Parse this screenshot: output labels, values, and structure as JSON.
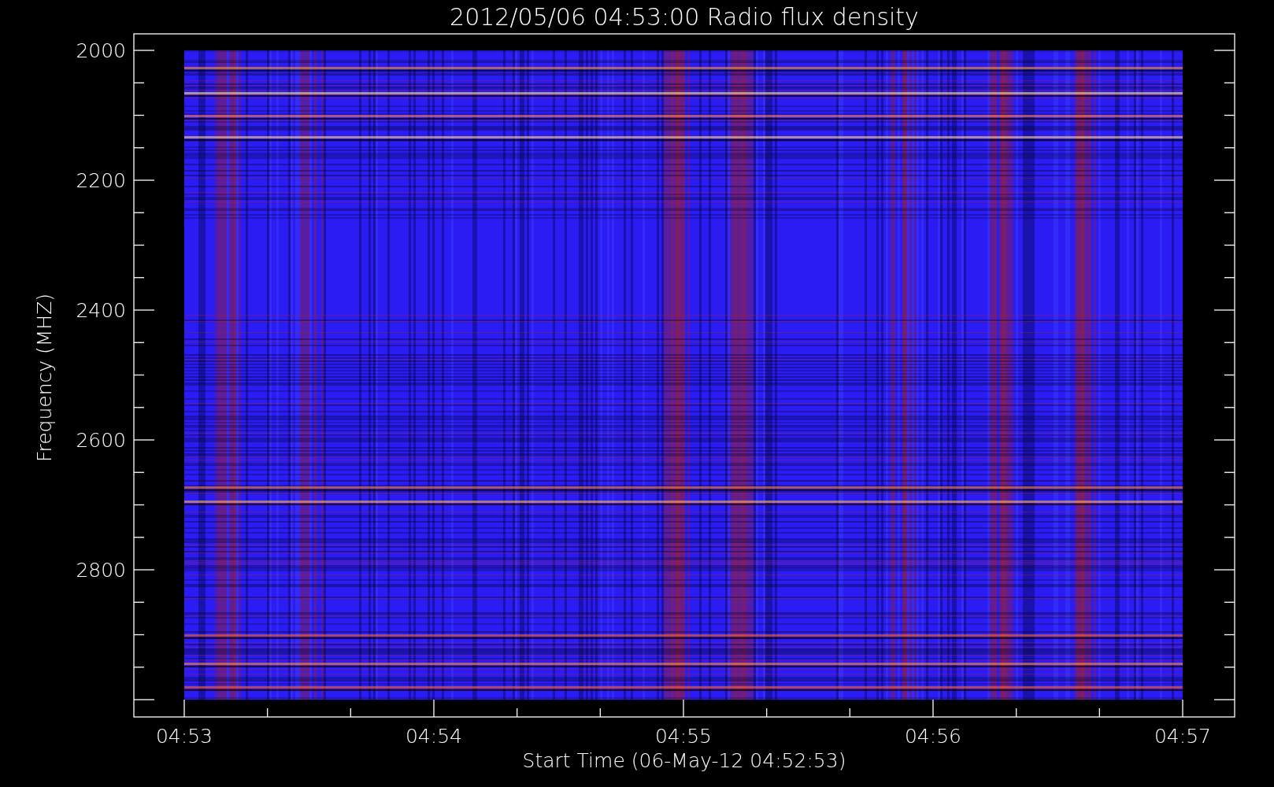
{
  "plot": {
    "title": "2012/05/06 04:53:00 Radio flux density",
    "y_axis": {
      "label": "Frequency (MHZ)",
      "ticks": [
        "2000",
        "2200",
        "2400",
        "2600",
        "2800"
      ]
    },
    "x_axis": {
      "label": "Start Time (06-May-12 04:52:53)",
      "ticks": [
        "04:53",
        "04:54",
        "04:55",
        "04:56",
        "04:57"
      ]
    }
  }
}
